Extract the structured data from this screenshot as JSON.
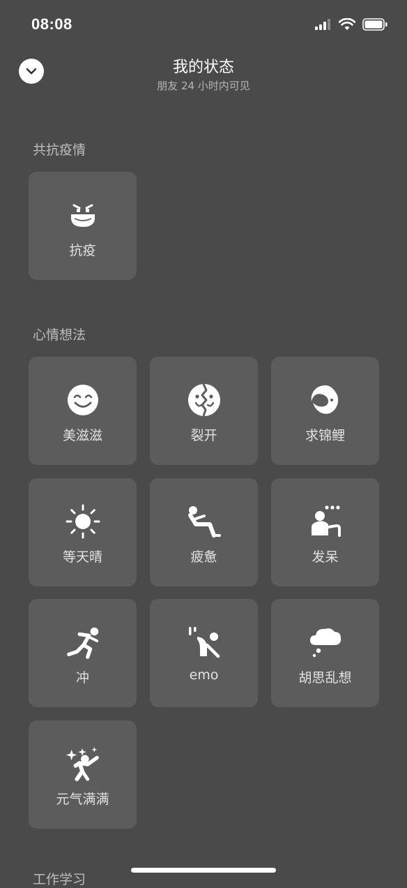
{
  "status": {
    "time": "08:08"
  },
  "header": {
    "title": "我的状态",
    "subtitle": "朋友 24 小时内可见"
  },
  "sections": {
    "fight": {
      "label": "共抗疫情"
    },
    "mood": {
      "label": "心情想法"
    },
    "work": {
      "label": "工作学习"
    }
  },
  "tiles": {
    "kangyi": "抗疫",
    "meizizi": "美滋滋",
    "liekai": "裂开",
    "qiujinli": "求锦鲤",
    "dengtianqing": "等天晴",
    "piyu": "疲惫",
    "fadai": "发呆",
    "chong": "冲",
    "emo": "emo",
    "husiluanxiang": "胡思乱想",
    "yuanqimanman": "元气满满"
  }
}
